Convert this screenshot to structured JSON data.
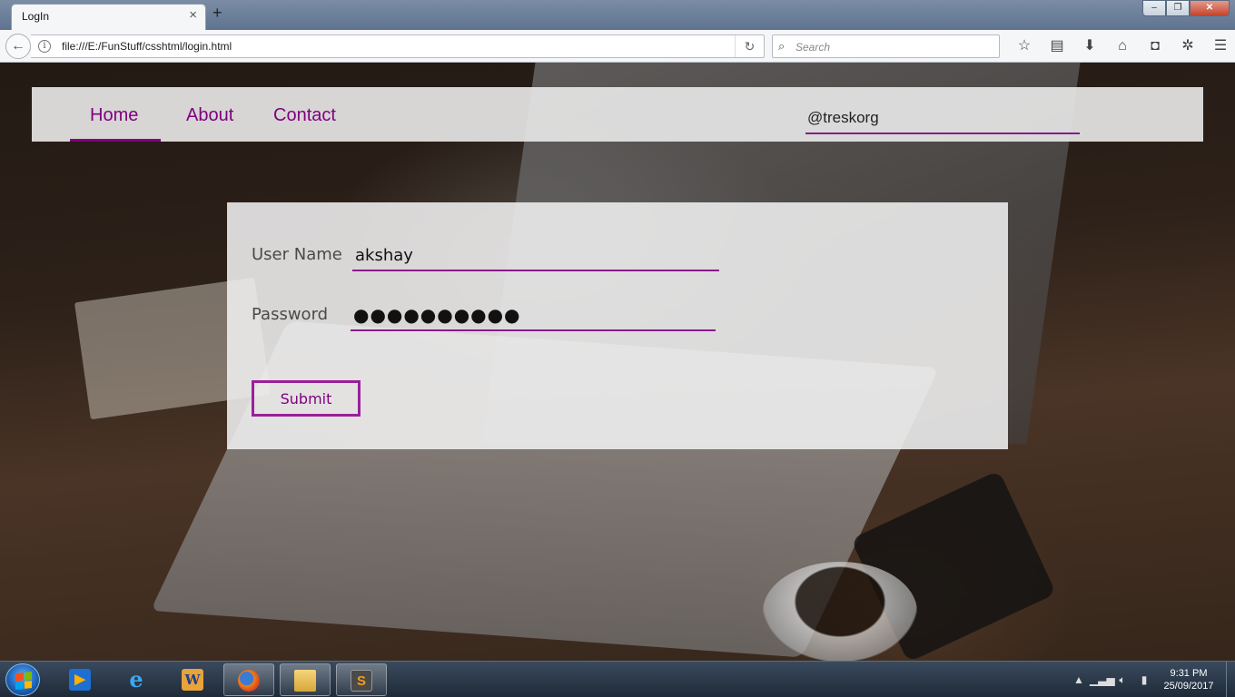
{
  "browser": {
    "tab_title": "LogIn",
    "tab_close": "×",
    "new_tab": "+",
    "url": "file:///E:/FunStuff/csshtml/login.html",
    "search_placeholder": "Search",
    "window_controls": [
      "–",
      "❐",
      "✕"
    ]
  },
  "site": {
    "nav": {
      "home": "Home",
      "about": "About",
      "contact": "Contact",
      "handle": "@treskorg"
    },
    "form": {
      "username_label": "User Name",
      "username_value": "akshay",
      "password_label": "Password",
      "password_value": "●●●●●●●●●●",
      "submit_label": "Submit"
    },
    "accent_color": "#800080"
  },
  "taskbar": {
    "apps": [
      "windows-media-player",
      "internet-explorer",
      "microsoft-word",
      "firefox",
      "windows-explorer",
      "sublime-text"
    ],
    "clock_time": "9:31 PM",
    "clock_date": "25/09/2017"
  }
}
